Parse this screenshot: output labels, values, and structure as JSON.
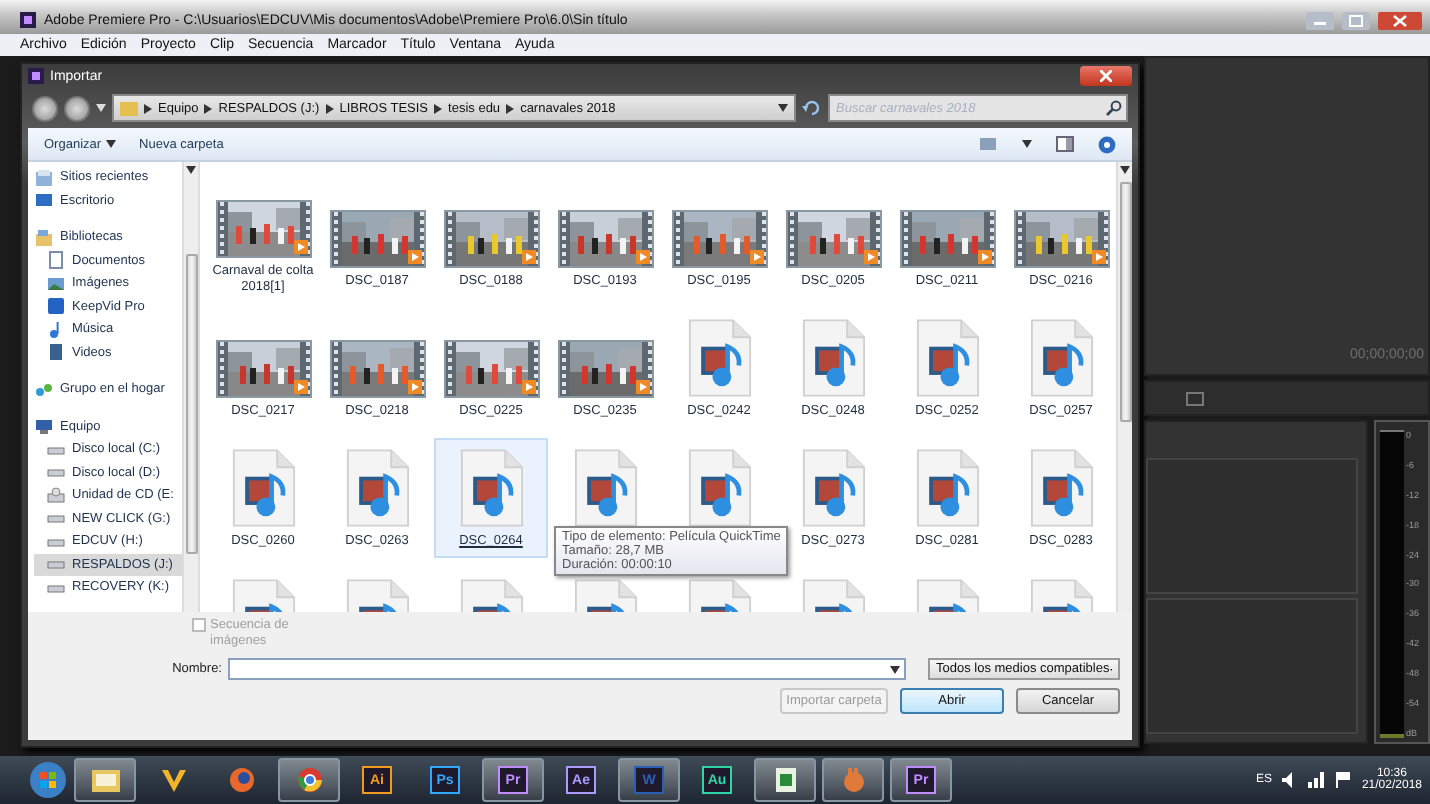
{
  "app_window": {
    "title": "Adobe Premiere Pro - C:\\Usuarios\\EDCUV\\Mis documentos\\Adobe\\Premiere Pro\\6.0\\Sin título"
  },
  "menu": [
    "Archivo",
    "Edición",
    "Proyecto",
    "Clip",
    "Secuencia",
    "Marcador",
    "Título",
    "Ventana",
    "Ayuda"
  ],
  "dialog": {
    "title": "Importar",
    "breadcrumb": [
      "Equipo",
      "RESPALDOS (J:)",
      "LIBROS TESIS",
      "tesis edu",
      "carnavales 2018"
    ],
    "search": {
      "placeholder": "Buscar carnavales 2018"
    },
    "toolbar": [
      "Organizar",
      "Nueva carpeta"
    ],
    "nav_groups": [
      {
        "items": [
          {
            "label": "Sitios recientes",
            "kind": "recent",
            "selected": false
          },
          {
            "label": "Escritorio",
            "kind": "desktop",
            "selected": false
          }
        ]
      },
      {
        "items": [
          {
            "label": "Bibliotecas",
            "kind": "library",
            "selected": false,
            "children": [
              {
                "label": "Documentos",
                "kind": "documents",
                "selected": false
              },
              {
                "label": "Imágenes",
                "kind": "images",
                "selected": false
              },
              {
                "label": "KeepVid Pro",
                "kind": "app",
                "selected": false
              },
              {
                "label": "Música",
                "kind": "music",
                "selected": false
              },
              {
                "label": "Videos",
                "kind": "videos",
                "selected": false
              }
            ]
          }
        ]
      },
      {
        "items": [
          {
            "label": "Grupo en el hogar",
            "kind": "homegroup",
            "selected": false
          }
        ]
      },
      {
        "items": [
          {
            "label": "Equipo",
            "kind": "computer",
            "selected": false,
            "children": [
              {
                "label": "Disco local (C:)",
                "kind": "drive",
                "selected": false
              },
              {
                "label": "Disco local (D:)",
                "kind": "drive",
                "selected": false
              },
              {
                "label": "Unidad de CD (E:",
                "kind": "cd",
                "selected": false
              },
              {
                "label": "NEW CLICK (G:)",
                "kind": "drive",
                "selected": false
              },
              {
                "label": "EDCUV (H:)",
                "kind": "drive",
                "selected": false
              },
              {
                "label": "RESPALDOS (J:)",
                "kind": "drive",
                "selected": true
              },
              {
                "label": "RECOVERY (K:)",
                "kind": "drive",
                "selected": false
              }
            ]
          }
        ]
      }
    ],
    "files": [
      {
        "name": "Carnaval de colta 2018[1]",
        "kind": "video",
        "selected": false
      },
      {
        "name": "DSC_0187",
        "kind": "video",
        "selected": false
      },
      {
        "name": "DSC_0188",
        "kind": "video",
        "selected": false
      },
      {
        "name": "DSC_0193",
        "kind": "video",
        "selected": false
      },
      {
        "name": "DSC_0195",
        "kind": "video",
        "selected": false
      },
      {
        "name": "DSC_0205",
        "kind": "video",
        "selected": false
      },
      {
        "name": "DSC_0211",
        "kind": "video",
        "selected": false
      },
      {
        "name": "DSC_0216",
        "kind": "video",
        "selected": false
      },
      {
        "name": "DSC_0217",
        "kind": "video",
        "selected": false
      },
      {
        "name": "DSC_0218",
        "kind": "video",
        "selected": false
      },
      {
        "name": "DSC_0225",
        "kind": "video",
        "selected": false
      },
      {
        "name": "DSC_0235",
        "kind": "video",
        "selected": false
      },
      {
        "name": "DSC_0242",
        "kind": "document",
        "selected": false
      },
      {
        "name": "DSC_0248",
        "kind": "document",
        "selected": false
      },
      {
        "name": "DSC_0252",
        "kind": "document",
        "selected": false
      },
      {
        "name": "DSC_0257",
        "kind": "document",
        "selected": false
      },
      {
        "name": "DSC_0260",
        "kind": "document",
        "selected": false
      },
      {
        "name": "DSC_0263",
        "kind": "document",
        "selected": false
      },
      {
        "name": "DSC_0264",
        "kind": "document",
        "selected": true
      },
      {
        "kind": "document",
        "selected": false
      },
      {
        "kind": "document",
        "selected": false
      },
      {
        "name": "DSC_0273",
        "kind": "document",
        "selected": false
      },
      {
        "name": "DSC_0281",
        "kind": "document",
        "selected": false
      },
      {
        "name": "DSC_0283",
        "kind": "document",
        "selected": false
      },
      {
        "kind": "document",
        "selected": false
      },
      {
        "kind": "document",
        "selected": false
      },
      {
        "kind": "document",
        "selected": false
      },
      {
        "kind": "document",
        "selected": false
      },
      {
        "kind": "document",
        "selected": false
      },
      {
        "kind": "document",
        "selected": false
      },
      {
        "kind": "document",
        "selected": false
      },
      {
        "kind": "document",
        "selected": false
      }
    ],
    "tooltip": [
      "Tipo de elemento: Película QuickTime",
      "Tamaño: 28,7 MB",
      "Duración: 00:00:10"
    ],
    "sequence_checkbox": {
      "label": "Secuencia de imágenes",
      "checked": false,
      "disabled": true
    },
    "name_field": {
      "label": "Nombre:"
    },
    "filter": {
      "value": "Todos los medios compatibles"
    },
    "buttons": [
      {
        "label": "Importar carpeta",
        "disabled": true,
        "default": false
      },
      {
        "label": "Abrir",
        "disabled": false,
        "default": true
      },
      {
        "label": "Cancelar",
        "disabled": false,
        "default": false
      }
    ]
  },
  "monitor": {
    "timecode": "00;00;00;00"
  },
  "meter_scale": [
    "0",
    "-6",
    "-12",
    "-18",
    "-24",
    "-30",
    "-36",
    "-42",
    "-48",
    "-54",
    "dB"
  ],
  "taskbar": {
    "apps": [
      {
        "kind": "folder",
        "running": true
      },
      {
        "kind": "vee",
        "running": false
      },
      {
        "kind": "firefox",
        "running": false
      },
      {
        "kind": "chrome",
        "running": true
      },
      {
        "kind": "badge",
        "label": "Ai",
        "color": "#f29a1f",
        "running": false
      },
      {
        "kind": "badge",
        "label": "Ps",
        "color": "#31a8ff",
        "running": false
      },
      {
        "kind": "badge",
        "label": "Pr",
        "color": "#c08cff",
        "running": true
      },
      {
        "kind": "badge",
        "label": "Ae",
        "color": "#a99bff",
        "running": false
      },
      {
        "kind": "badge",
        "label": "W",
        "color": "#2b5fb4",
        "running": true
      },
      {
        "kind": "badge",
        "label": "Au",
        "color": "#2ed5a6",
        "running": false
      },
      {
        "kind": "sheet",
        "running": true
      },
      {
        "kind": "hand",
        "running": true
      },
      {
        "kind": "badge",
        "label": "Pr",
        "color": "#c08cff",
        "running": true
      }
    ],
    "language": "ES",
    "time": "10:36",
    "date": "21/02/2018"
  }
}
